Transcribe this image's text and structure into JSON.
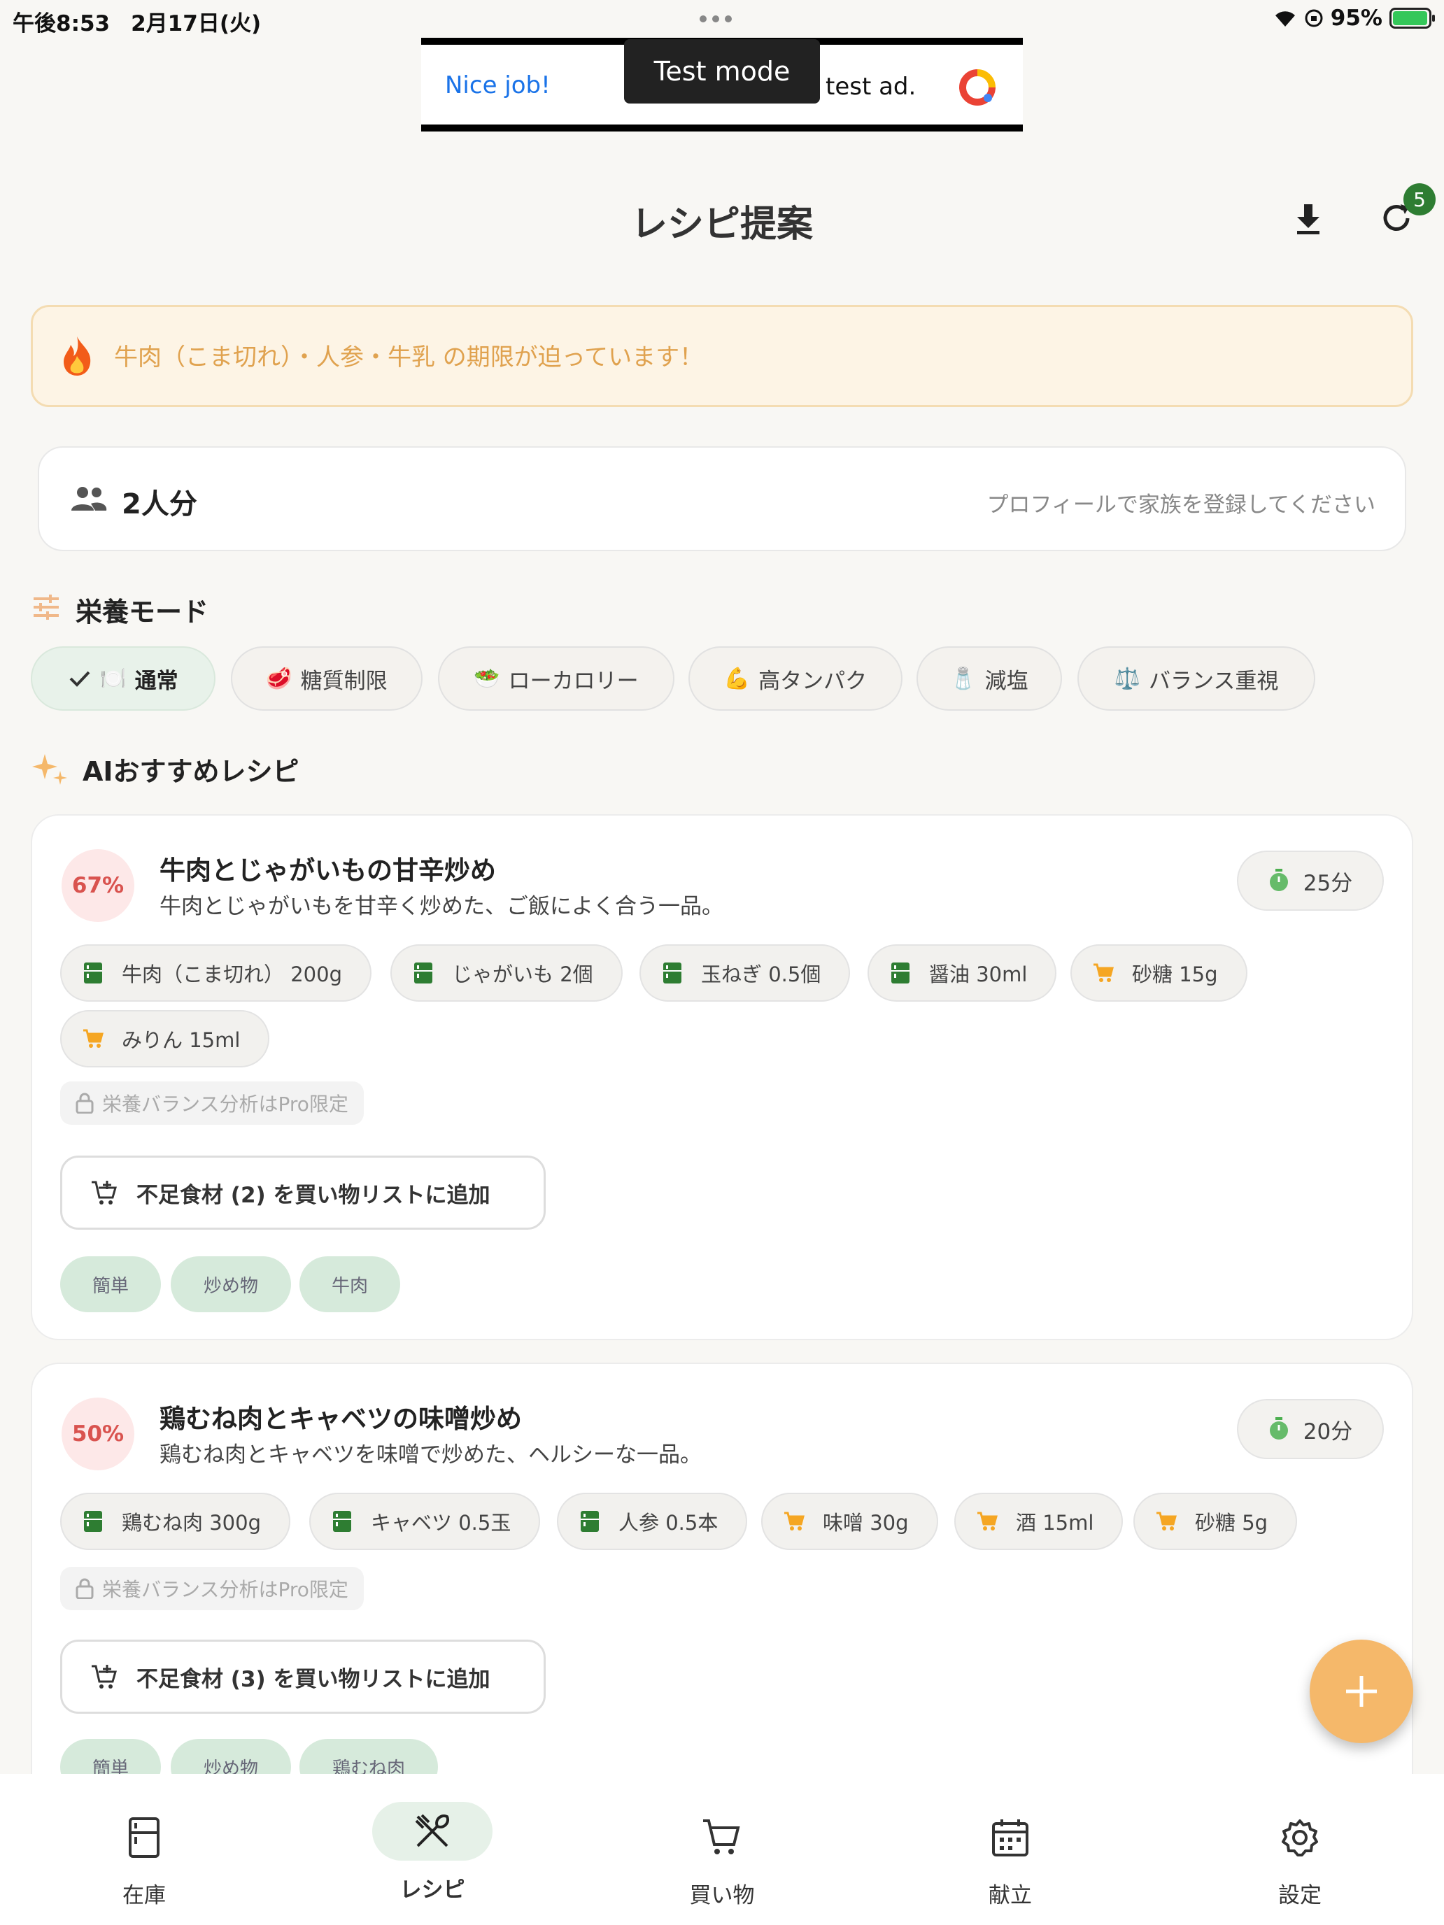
{
  "status_bar": {
    "time": "午後8:53",
    "date": "2月17日(火)",
    "battery": "95%"
  },
  "ad": {
    "nice": "Nice job!",
    "mode": "Test mode",
    "text": "test ad."
  },
  "header": {
    "title": "レシピ提案",
    "badge_count": "5"
  },
  "warning": {
    "text": "牛肉（こま切れ）・人参・牛乳 の期限が迫っています！"
  },
  "servings": {
    "label": "2人分",
    "hint": "プロフィールで家族を登録してください"
  },
  "nutrition_mode": {
    "title": "栄養モード",
    "chips": [
      {
        "emoji": "🍽️",
        "label": "通常"
      },
      {
        "emoji": "🥩",
        "label": "糖質制限"
      },
      {
        "emoji": "🥗",
        "label": "ローカロリー"
      },
      {
        "emoji": "💪",
        "label": "高タンパク"
      },
      {
        "emoji": "🧂",
        "label": "減塩"
      },
      {
        "emoji": "⚖️",
        "label": "バランス重視"
      }
    ]
  },
  "ai": {
    "title": "AIおすすめレシピ"
  },
  "recipes": [
    {
      "match": "67%",
      "title": "牛肉とじゃがいもの甘辛炒め",
      "desc": "牛肉とじゃがいもを甘辛く炒めた、ご飯によく合う一品。",
      "time": "25分",
      "ingredients": [
        {
          "label": "牛肉（こま切れ） 200g",
          "icon": "fridge-icon"
        },
        {
          "label": "じゃがいも 2個",
          "icon": "fridge-icon"
        },
        {
          "label": "玉ねぎ 0.5個",
          "icon": "fridge-icon"
        },
        {
          "label": "醤油 30ml",
          "icon": "fridge-icon"
        },
        {
          "label": "砂糖 15g",
          "icon": "cart-icon"
        },
        {
          "label": "みりん 15ml",
          "icon": "cart-icon"
        }
      ],
      "pro": "栄養バランス分析はPro限定",
      "add": "不足食材 (2) を買い物リストに追加",
      "tags": [
        "簡単",
        "炒め物",
        "牛肉"
      ]
    },
    {
      "match": "50%",
      "title": "鶏むね肉とキャベツの味噌炒め",
      "desc": "鶏むね肉とキャベツを味噌で炒めた、ヘルシーな一品。",
      "time": "20分",
      "ingredients": [
        {
          "label": "鶏むね肉 300g",
          "icon": "fridge-icon"
        },
        {
          "label": "キャベツ 0.5玉",
          "icon": "fridge-icon"
        },
        {
          "label": "人参 0.5本",
          "icon": "fridge-icon"
        },
        {
          "label": "味噌 30g",
          "icon": "cart-icon"
        },
        {
          "label": "酒 15ml",
          "icon": "cart-icon"
        },
        {
          "label": "砂糖 5g",
          "icon": "cart-icon"
        }
      ],
      "pro": "栄養バランス分析はPro限定",
      "add": "不足食材 (3) を買い物リストに追加",
      "tags": [
        "簡単",
        "炒め物",
        "鶏むね肉"
      ]
    }
  ],
  "nav": [
    {
      "label": "在庫"
    },
    {
      "label": "レシピ"
    },
    {
      "label": "買い物"
    },
    {
      "label": "献立"
    },
    {
      "label": "設定"
    }
  ],
  "colors": {
    "accent_green": "#2e7d32",
    "warning_text": "#e0a24f",
    "fab": "#f5b86a",
    "match_red": "#d9534f"
  }
}
